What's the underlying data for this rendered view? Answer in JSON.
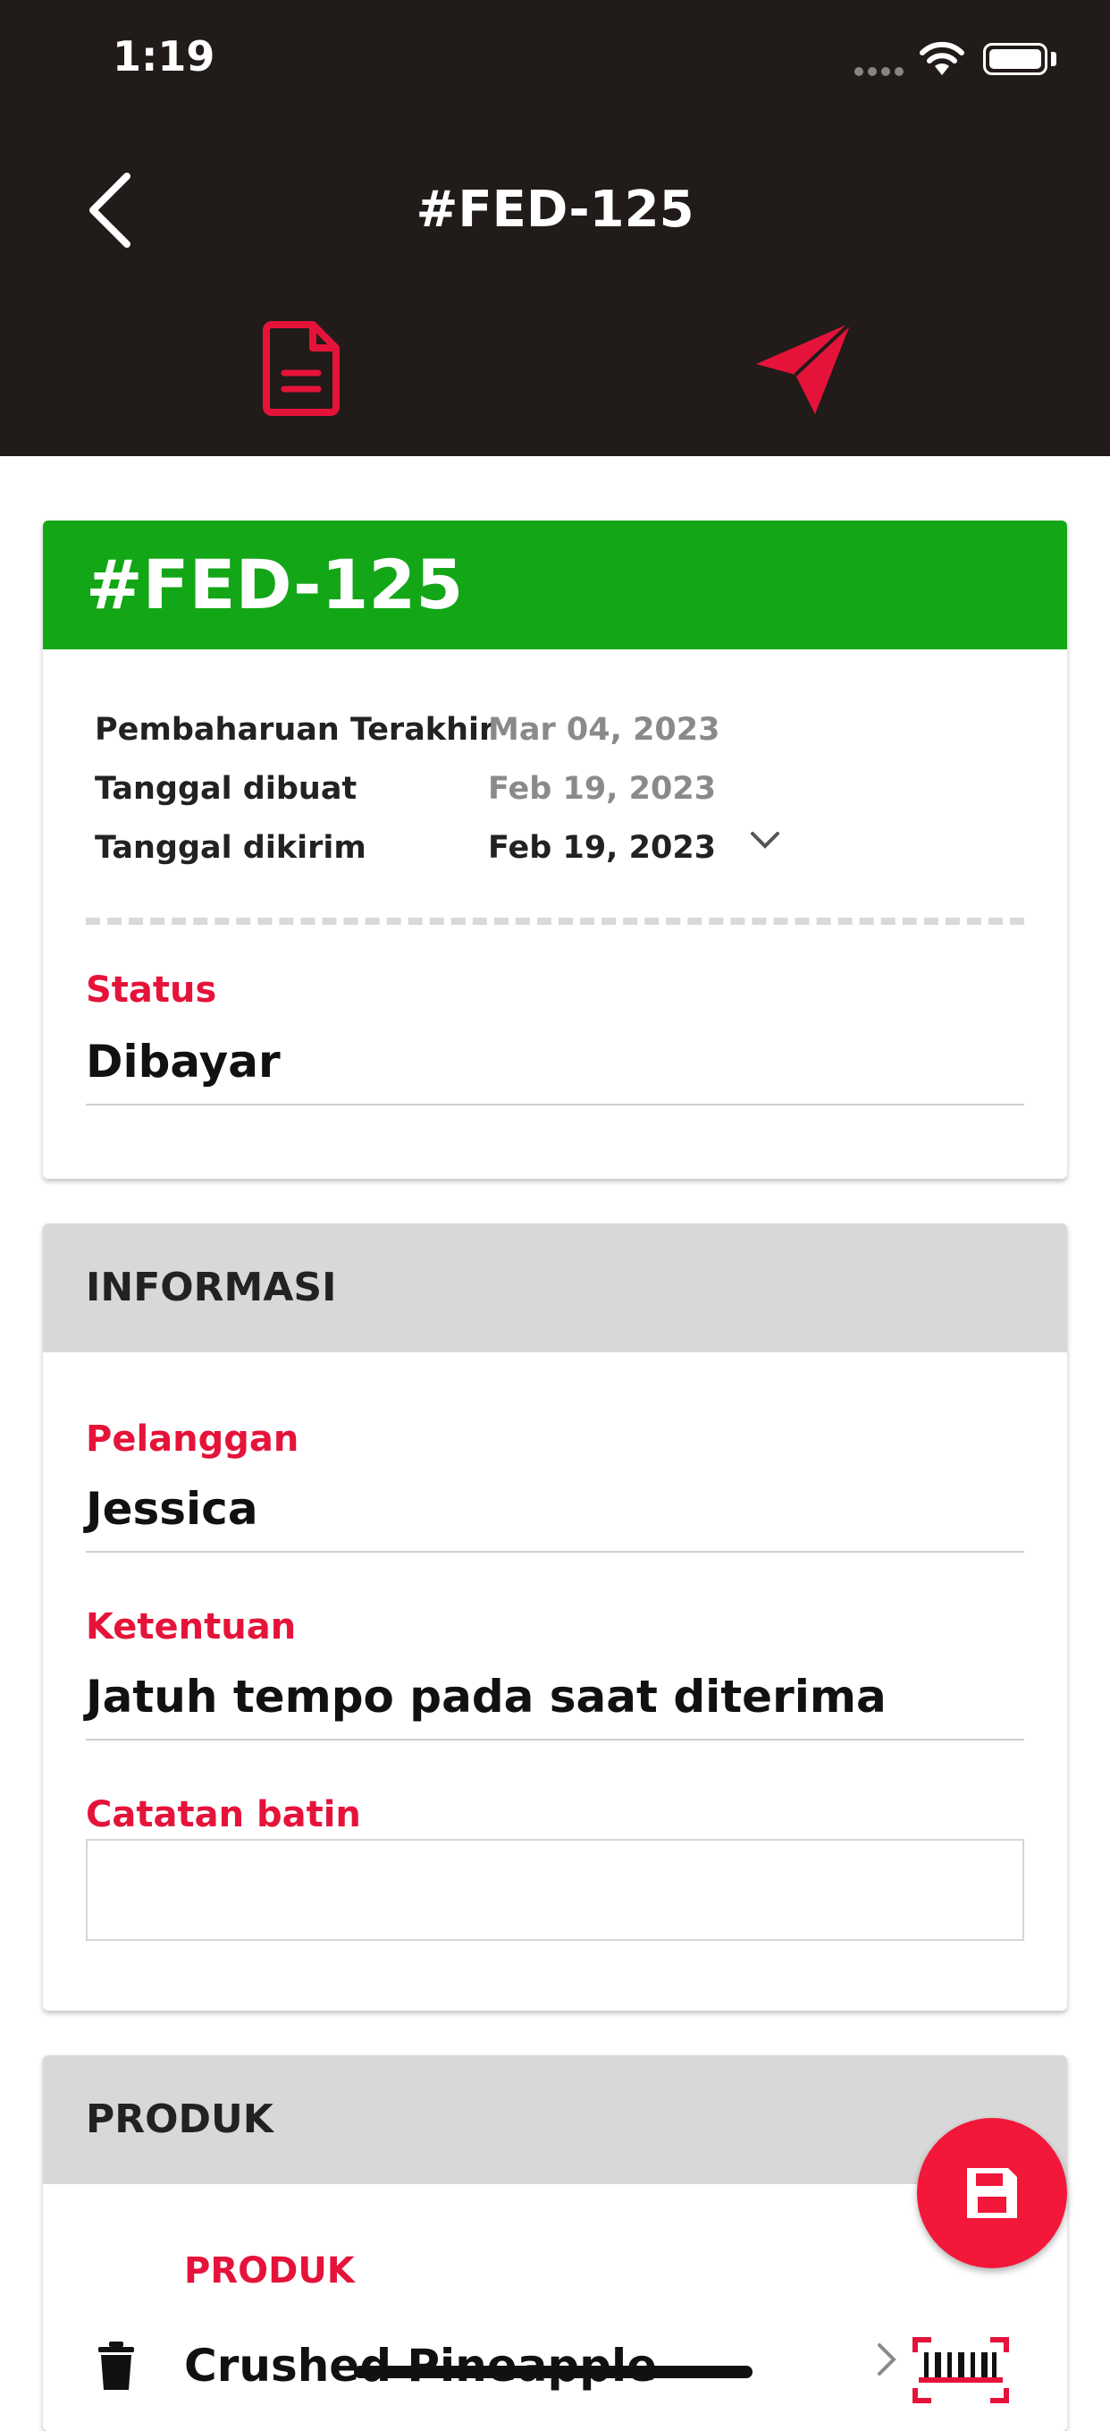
{
  "status_bar": {
    "time": "1:19"
  },
  "header": {
    "title": "#FED-125"
  },
  "order_card": {
    "id": "#FED-125",
    "header_color": "#13a617",
    "meta": [
      {
        "label": "Pembaharuan Terakhir",
        "value": "Mar 04, 2023"
      },
      {
        "label": "Tanggal dibuat",
        "value": "Feb 19, 2023"
      },
      {
        "label": "Tanggal dikirim",
        "value": "Feb 19, 2023"
      }
    ],
    "status_label": "Status",
    "status_value": "Dibayar"
  },
  "informasi": {
    "title": "INFORMASI",
    "customer_label": "Pelanggan",
    "customer_value": "Jessica",
    "terms_label": "Ketentuan",
    "terms_value": "Jatuh tempo pada saat diterima",
    "notes_label": "Catatan batin",
    "notes_value": ""
  },
  "produk": {
    "title": "PRODUK",
    "column_label": "PRODUK",
    "items": [
      {
        "name": "Crushed Pineapple"
      }
    ]
  },
  "colors": {
    "accent": "#e5133a",
    "dark": "#211b19",
    "fab": "#f3173a"
  },
  "icons": [
    "back-icon",
    "document-icon",
    "send-icon",
    "chevron-down-icon",
    "trash-icon",
    "chevron-right-icon",
    "barcode-scan-icon",
    "save-icon"
  ]
}
